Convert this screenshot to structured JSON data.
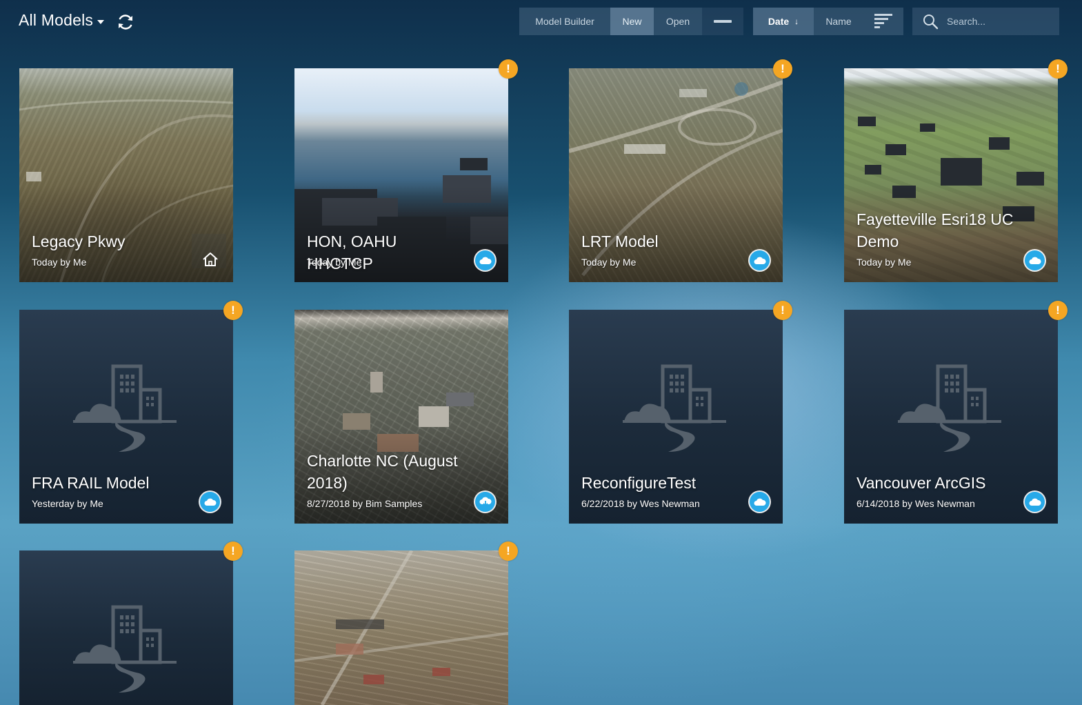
{
  "header": {
    "title": "All Models",
    "buttons": {
      "model_builder": "Model Builder",
      "new": "New",
      "open": "Open"
    },
    "sort": {
      "date": "Date",
      "date_arrow": "↓",
      "name": "Name"
    },
    "search": {
      "placeholder": "Search..."
    }
  },
  "colors": {
    "warning": "#f5a623",
    "cloud": "#27a9e8",
    "card_dark": "#1c2b3b"
  },
  "models": [
    {
      "name": "Legacy Pkwy",
      "meta": "Today by Me",
      "status_icon": "home-icon",
      "warning": false
    },
    {
      "name": "HON, OAHU HHCTCP",
      "meta": "Today by Me",
      "status_icon": "cloud-icon",
      "warning": true
    },
    {
      "name": "LRT Model",
      "meta": "Today by Me",
      "status_icon": "cloud-icon",
      "warning": true
    },
    {
      "name": "Fayetteville Esri18 UC Demo",
      "meta": "Today by Me",
      "status_icon": "cloud-icon",
      "warning": true
    },
    {
      "name": "FRA RAIL Model",
      "meta": "Yesterday by Me",
      "status_icon": "cloud-icon",
      "warning": true
    },
    {
      "name": "Charlotte NC (August 2018)",
      "meta": "8/27/2018 by Bim Samples",
      "status_icon": "cloud-download-icon",
      "warning": false
    },
    {
      "name": "ReconfigureTest",
      "meta": "6/22/2018 by Wes Newman",
      "status_icon": "cloud-icon",
      "warning": true
    },
    {
      "name": "Vancouver ArcGIS",
      "meta": "6/14/2018 by Wes Newman",
      "status_icon": "cloud-icon",
      "warning": true
    },
    {
      "warning": true
    },
    {
      "warning": true
    }
  ],
  "warning_glyph": "!"
}
